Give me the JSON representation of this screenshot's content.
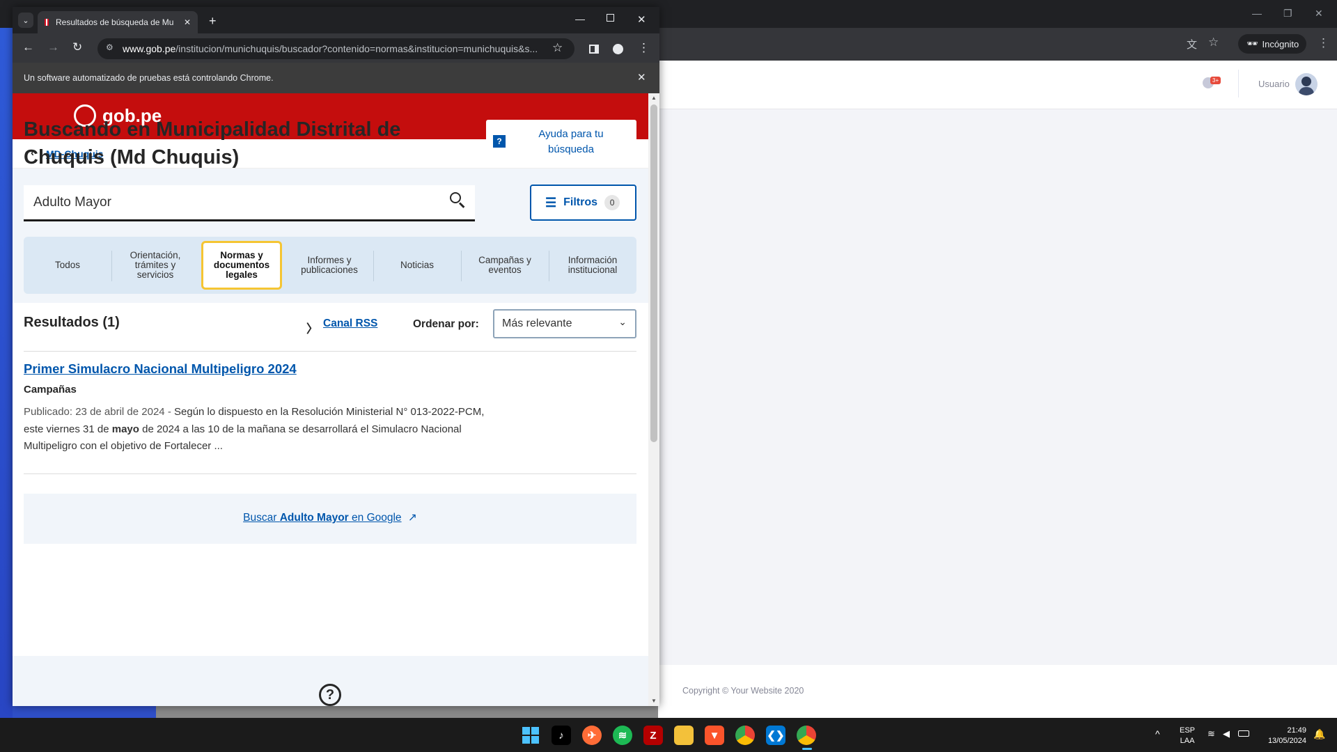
{
  "browser": {
    "tab_title": "Resultados de búsqueda de Mu",
    "url_host": "www.gob.pe",
    "url_path": "/institucion/munichuquis/buscador?contenido=normas&institucion=munichuquis&s...",
    "infobar_text": "Un software automatizado de pruebas está controlando Chrome."
  },
  "background_window": {
    "incognito_label": "Incógnito",
    "user_label": "Usuario",
    "notification_badge": "3+",
    "footer_copyright": "Copyright © Your Website 2020"
  },
  "page": {
    "logo_text": "gob.pe",
    "breadcrumb": "MD-Chuquis",
    "heading": "Buscando en Municipalidad Distrital de Chuquis (Md Chuquis)",
    "help_button": "Ayuda para tu búsqueda",
    "search_value": "Adulto Mayor",
    "filters_label": "Filtros",
    "filters_count": "0",
    "category_tabs": [
      "Todos",
      "Orientación, trámites y servicios",
      "Normas y documentos legales",
      "Informes y publicaciones",
      "Noticias",
      "Campañas y eventos",
      "Información institucional"
    ],
    "selected_tab": "Normas y documentos legales",
    "results_heading": "Resultados (1)",
    "rss_label": "Canal RSS",
    "sort_label": "Ordenar por:",
    "sort_value": "Más relevante",
    "result": {
      "title": "Primer Simulacro Nacional Multipeligro 2024",
      "category": "Campañas",
      "published": "Publicado: 23 de abril de 2024",
      "snippet_a": "Según lo dispuesto en la Resolución Ministerial N° 013-2022-PCM, este viernes 31 de ",
      "snippet_bold": "mayo",
      "snippet_b": " de 2024 a las 10 de la mañana se desarrollará el Simulacro Nacional Multipeligro con el objetivo de Fortalecer ..."
    },
    "google_prefix": "Buscar ",
    "google_query": "Adulto Mayor",
    "google_suffix": " en Google"
  },
  "taskbar": {
    "lang_top": "ESP",
    "lang_bottom": "LAA",
    "time": "21:49",
    "date": "13/05/2024"
  },
  "colors": {
    "gob_red": "#c40d0d",
    "link_blue": "#0056ac",
    "selected_tab_border": "#f5c533"
  }
}
